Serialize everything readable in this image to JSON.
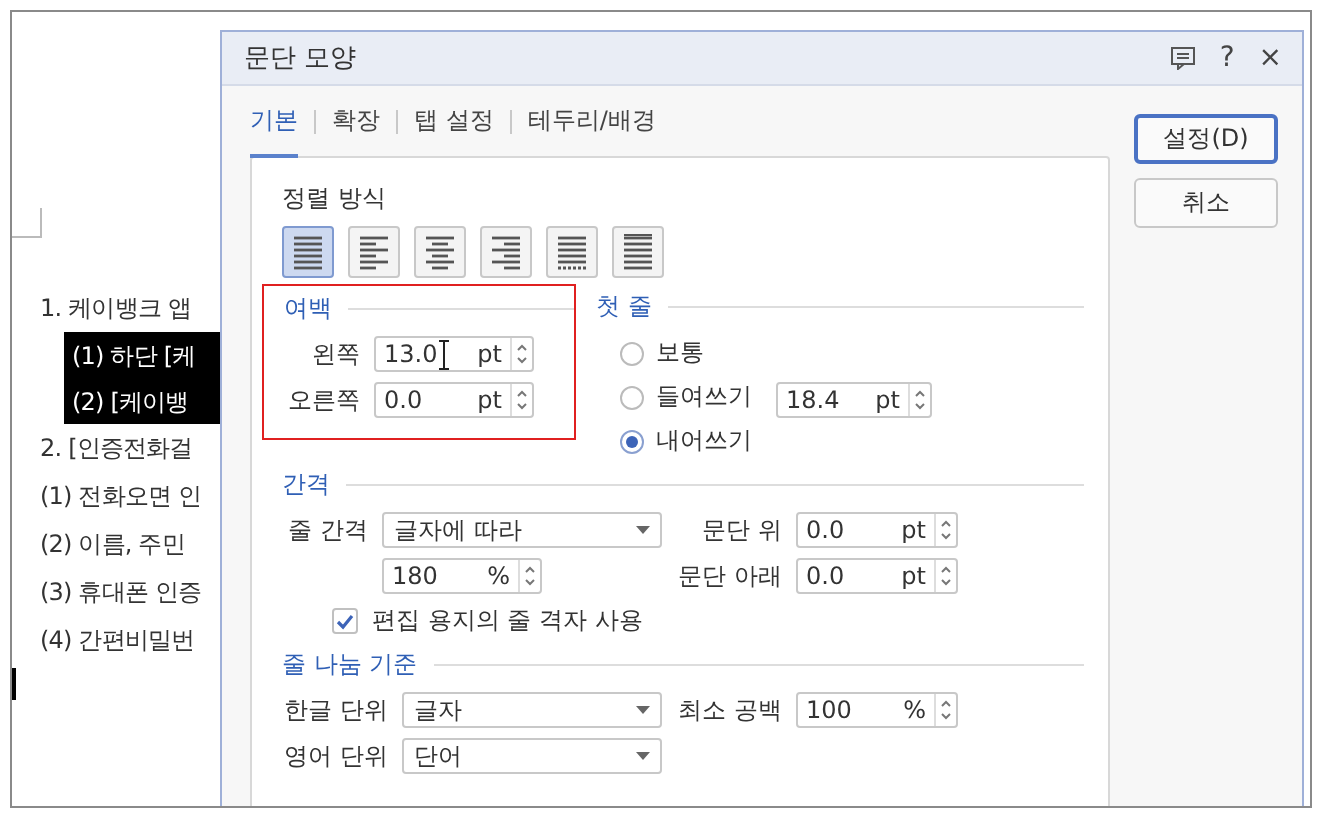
{
  "document": {
    "items": [
      {
        "text": "1. 케이뱅크 앱",
        "highlighted": false,
        "children": [
          {
            "text": "(1) 하단 [케",
            "highlighted": true
          },
          {
            "text": "(2) [케이뱅",
            "highlighted": true
          }
        ]
      },
      {
        "text": "2. [인증전화걸",
        "highlighted": false
      },
      {
        "text": "(1) 전화오면 인",
        "highlighted": false
      },
      {
        "text": "(2) 이름, 주민",
        "highlighted": false
      },
      {
        "text": "(3) 휴대폰 인증",
        "highlighted": false
      },
      {
        "text": "(4) 간편비밀번",
        "highlighted": false
      }
    ]
  },
  "dialog": {
    "title": "문단 모양",
    "title_buttons": [
      "?",
      "×"
    ],
    "tabs": [
      {
        "label": "기본",
        "selected": true
      },
      {
        "label": "확장",
        "selected": false
      },
      {
        "label": "탭 설정",
        "selected": false
      },
      {
        "label": "테두리/배경",
        "selected": false
      }
    ],
    "buttons": [
      {
        "label": "설정(D)",
        "default": true
      },
      {
        "label": "취소",
        "default": false
      }
    ],
    "alignment": {
      "title": "정렬 방식",
      "options": [
        {
          "kind": "justify",
          "selected": true
        },
        {
          "kind": "left",
          "selected": false
        },
        {
          "kind": "center",
          "selected": false
        },
        {
          "kind": "right",
          "selected": false
        },
        {
          "kind": "distribute",
          "selected": false
        },
        {
          "kind": "divide",
          "selected": false
        }
      ]
    },
    "margin": {
      "title": "여백",
      "annotated": true,
      "fields": [
        {
          "label": "왼쪽",
          "value": "13.0",
          "unit": "pt"
        },
        {
          "label": "오른쪽",
          "value": "0.0",
          "unit": "pt"
        }
      ]
    },
    "first_line": {
      "title": "첫 줄",
      "options": [
        {
          "label": "보통",
          "selected": false
        },
        {
          "label": "들여쓰기",
          "selected": false
        },
        {
          "label": "내어쓰기",
          "selected": true
        }
      ],
      "field": {
        "value": "18.4",
        "unit": "pt"
      }
    },
    "spacing": {
      "title": "간격",
      "line_spacing": {
        "label": "줄 간격",
        "value": "글자에 따라",
        "amount": "180",
        "unit": "%"
      },
      "grid_checkbox": {
        "label": "편집 용지의 줄 격자 사용",
        "checked": true
      },
      "before": {
        "label": "문단 위",
        "value": "0.0",
        "unit": "pt"
      },
      "after": {
        "label": "문단 아래",
        "value": "0.0",
        "unit": "pt"
      }
    },
    "line_break": {
      "title": "줄 나눔 기준",
      "korean": {
        "label": "한글 단위",
        "value": "글자"
      },
      "english": {
        "label": "영어 단위",
        "value": "단어"
      },
      "min_space": {
        "label": "최소 공백",
        "value": "100",
        "unit": "%"
      }
    }
  }
}
